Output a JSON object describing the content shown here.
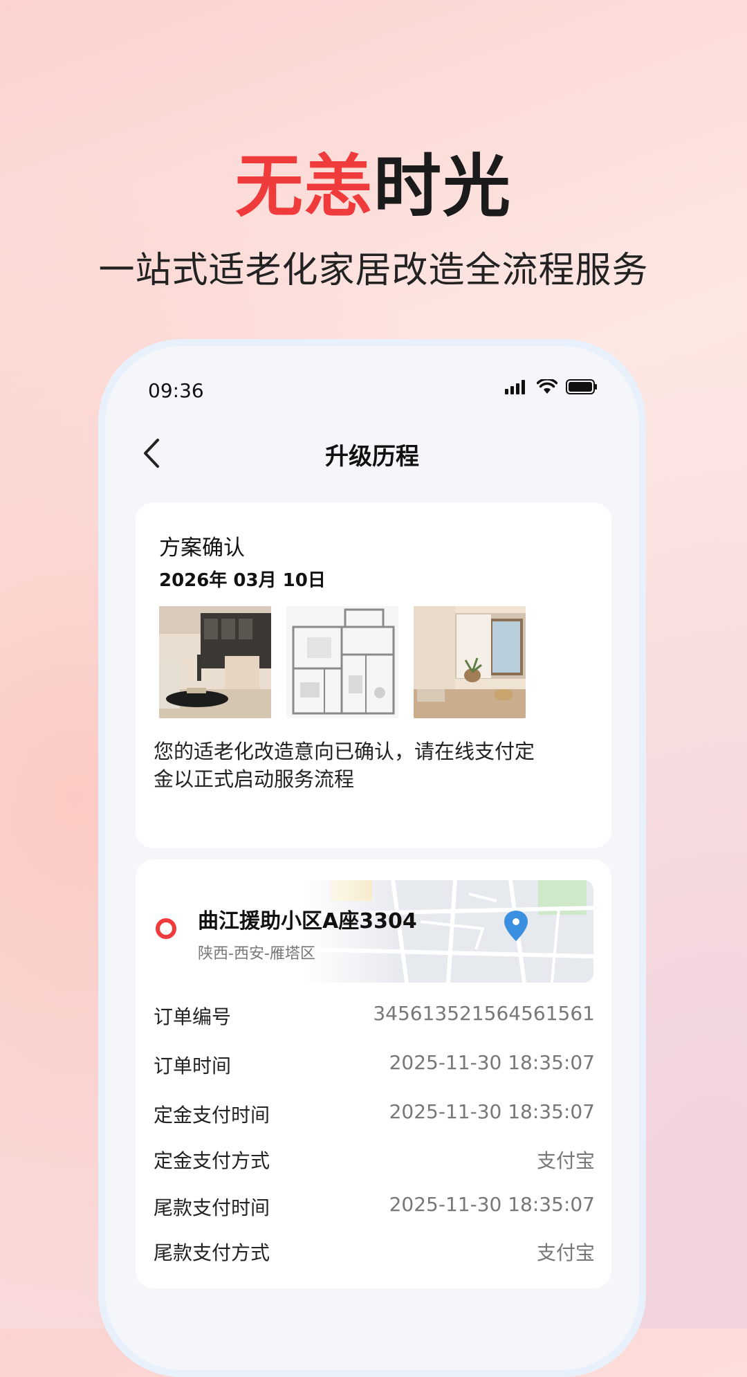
{
  "marketing": {
    "headline_red": "无恙",
    "headline_dark": "时光",
    "subheadline": "一站式适老化家居改造全流程服务"
  },
  "status_bar": {
    "time": "09:36",
    "icons": [
      "signal-icon",
      "wifi-icon",
      "battery-icon"
    ]
  },
  "nav": {
    "title": "升级历程",
    "back_icon": "chevron-left-icon"
  },
  "plan_card": {
    "title": "方案确认",
    "date": "2026年 03月 10日",
    "images": [
      "living-room-photo",
      "floor-plan-image",
      "balcony-room-photo"
    ],
    "description": "您的适老化改造意向已确认，请在线支付定金以正式启动服务流程"
  },
  "address": {
    "name": "曲江援助小区A座3304",
    "region": "陕西-西安-雁塔区"
  },
  "order_rows": [
    {
      "label": "订单编号",
      "value": "345613521564561561"
    },
    {
      "label": "订单时间",
      "value": "2025-11-30 18:35:07"
    },
    {
      "label": "定金支付时间",
      "value": "2025-11-30 18:35:07"
    },
    {
      "label": "定金支付方式",
      "value": "支付宝"
    },
    {
      "label": "尾款支付时间",
      "value": "2025-11-30 18:35:07"
    },
    {
      "label": "尾款支付方式",
      "value": "支付宝"
    }
  ],
  "colors": {
    "accent_red": "#ef3b3b",
    "map_pin_blue": "#3b8fe0",
    "screen_bg": "#f4f6f9"
  }
}
